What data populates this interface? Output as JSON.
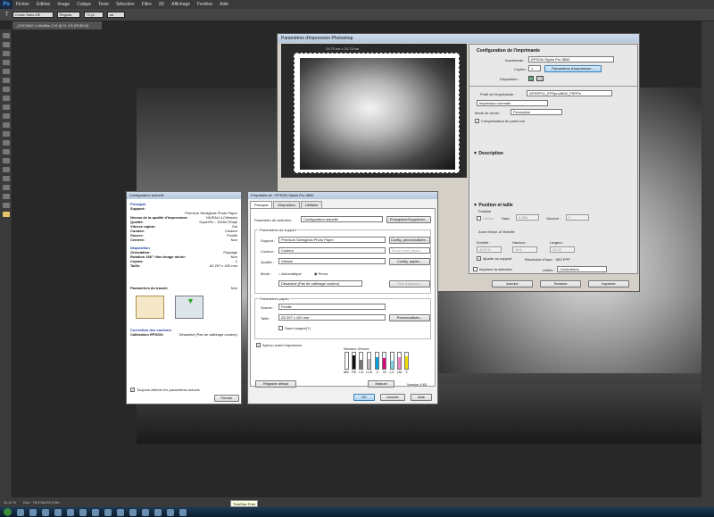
{
  "photoshop": {
    "logo": "Ps",
    "menu": [
      "Fichier",
      "Edition",
      "Image",
      "Calque",
      "Texte",
      "Sélection",
      "Filtre",
      "3D",
      "Affichage",
      "Fenêtre",
      "Aide"
    ],
    "options": {
      "font": "Comic Sans MS",
      "style": "Regular",
      "size": "72 pt",
      "text": "aa"
    },
    "doc_tab": "_DSC0842-1-Modifier-2.tif @ 11.1% (RVB/16)",
    "status": {
      "zoom": "11,11 %",
      "doc": "Doc : 76,9 Mo/76,9 Mo"
    },
    "taskbar_tooltip": "TreeSize Free"
  },
  "print_dialog": {
    "title": "Paramètres d'impression Photoshop",
    "preview_dims": "29,70 cm x 24,78 cm",
    "printer_config": {
      "heading": "Configuration de l'imprimante",
      "printer_label": "Imprimante :",
      "printer_value": "EPSON Stylus Pro 3800",
      "copies_label": "Copies :",
      "copies_value": "1",
      "settings_button": "Paramètres d'impression...",
      "layout_label": "Disposition :"
    },
    "color": {
      "profile_label": "Profil de l'imprimante :",
      "profile_value": "GPSPP11_EPSpro3800_PSPPn",
      "normal_print": "Impression normale",
      "intent_label": "Mode de rendu :",
      "intent_value": "Perception",
      "bpc_label": "Compensation du point noir"
    },
    "description_heading": "Description",
    "position": {
      "heading": "Position et taille",
      "sub": "Position",
      "center_label": "Centre",
      "top_label": "Haut :",
      "top_value": "6,356",
      "left_label": "Gauche :",
      "left_value": "0"
    },
    "scaled": {
      "sub": "Zone d'impr. à l'échelle",
      "scale_label": "Echelle :",
      "scale_value": "42,8 %",
      "height_label": "Hauteur :",
      "height_value": "15,5",
      "width_label": "Largeur :",
      "width_value": "20,42",
      "fit_label": "Ajuster au support",
      "resolution": "Résolution d'impr. : 560 PPP"
    },
    "print_selection": "Imprimer la sélection",
    "units_label": "Unités :",
    "units_value": "Centimètres",
    "buttons": {
      "cancel": "Annuler",
      "done": "Terminer",
      "print": "Imprimer"
    }
  },
  "config_window": {
    "title": "Configuration actuelle",
    "principal": "Principal",
    "rows1": [
      {
        "k": "Support:",
        "v": ""
      },
      {
        "k": "",
        "v": "Premium Semigloss Photo Paper"
      },
      {
        "k": "Niveau de la qualité d'impression:",
        "v": "NIVEAU 4 (Vitesse)"
      },
      {
        "k": "Qualité:",
        "v": "SuperFin - 1440x720dpi"
      },
      {
        "k": "Vitesse rapide:",
        "v": "Oui"
      },
      {
        "k": "Couleur:",
        "v": "Couleur"
      },
      {
        "k": "Source:",
        "v": "Feuille"
      },
      {
        "k": "Centrée:",
        "v": "Non"
      }
    ],
    "disposition": "Disposition",
    "rows2": [
      {
        "k": "Orientation:",
        "v": "Paysage"
      },
      {
        "k": "Rotation 180°:   Non   Image miroir:",
        "v": "Non"
      },
      {
        "k": "Copies:",
        "v": "1"
      },
      {
        "k": "Taille:",
        "v": "A3 297 x 420 mm"
      }
    ],
    "job": {
      "k": "Paramètres du travail:",
      "v": "Non"
    },
    "color_corr": "Correction des couleurs",
    "calib": {
      "k": "Calibration EPSON:",
      "v": "Désactivé (Pas de calibrage couleur)"
    },
    "always_show": "Toujours afficher les paramètres actuels.",
    "close": "Fermer"
  },
  "epson": {
    "title": "Propriétés de : EPSON Stylus Pro 3800",
    "tabs": [
      "Principal",
      "Disposition",
      "Utilitaire"
    ],
    "preset_label": "Paramètre de sélection :",
    "preset_value": "Configuration actuelle",
    "save_btn": "Enregistrer/Supprimer...",
    "media_group": "Paramètres du support",
    "support_label": "Support :",
    "support_value": "Premium Semigloss Photo Paper",
    "custom_btn": "Config. personnalisée...",
    "color_label": "Couleur :",
    "color_value": "Couleur",
    "color_mode": "Encre noire photo",
    "quality_label": "Qualité :",
    "quality_value": "Vitesse",
    "paper_btn": "Config. papier...",
    "mode_label": "Mode :",
    "mode_auto": "Automatique",
    "mode_custom": "Perso.",
    "mode_value": "Désactivé (Pas de calibrage couleur)",
    "plus_btn": "Plus d'options...",
    "paper_group": "Paramètres papier",
    "source_label": "Source :",
    "source_value": "Feuille",
    "size_label": "Taille :",
    "size_value": "A3 297 x 420 mm",
    "custom_size_btn": "Personnalisée...",
    "borderless": "Sans marges(Y)",
    "preview_label": "Aperçu avant impression",
    "ink_heading": "Niveaux d'encre",
    "inks": [
      {
        "name": "PK",
        "color": "#111111",
        "level": 0.85
      },
      {
        "name": "LK",
        "color": "#777777",
        "level": 0.55
      },
      {
        "name": "LLK",
        "color": "#bbbbbb",
        "level": 0.6
      },
      {
        "name": "C",
        "color": "#00a0e0",
        "level": 0.7
      },
      {
        "name": "M",
        "color": "#e0007a",
        "level": 0.65
      },
      {
        "name": "LC",
        "color": "#80d0f0",
        "level": 0.5
      },
      {
        "name": "LM",
        "color": "#f080c0",
        "level": 0.7
      },
      {
        "name": "Y",
        "color": "#f0e000",
        "level": 0.8
      }
    ],
    "mk_label": "MK",
    "default_btn": "Réglable défaut",
    "manual_btn": "Manuel",
    "version": "Version 6.63",
    "ok": "OK",
    "cancel": "Annuler",
    "help": "Aide"
  }
}
